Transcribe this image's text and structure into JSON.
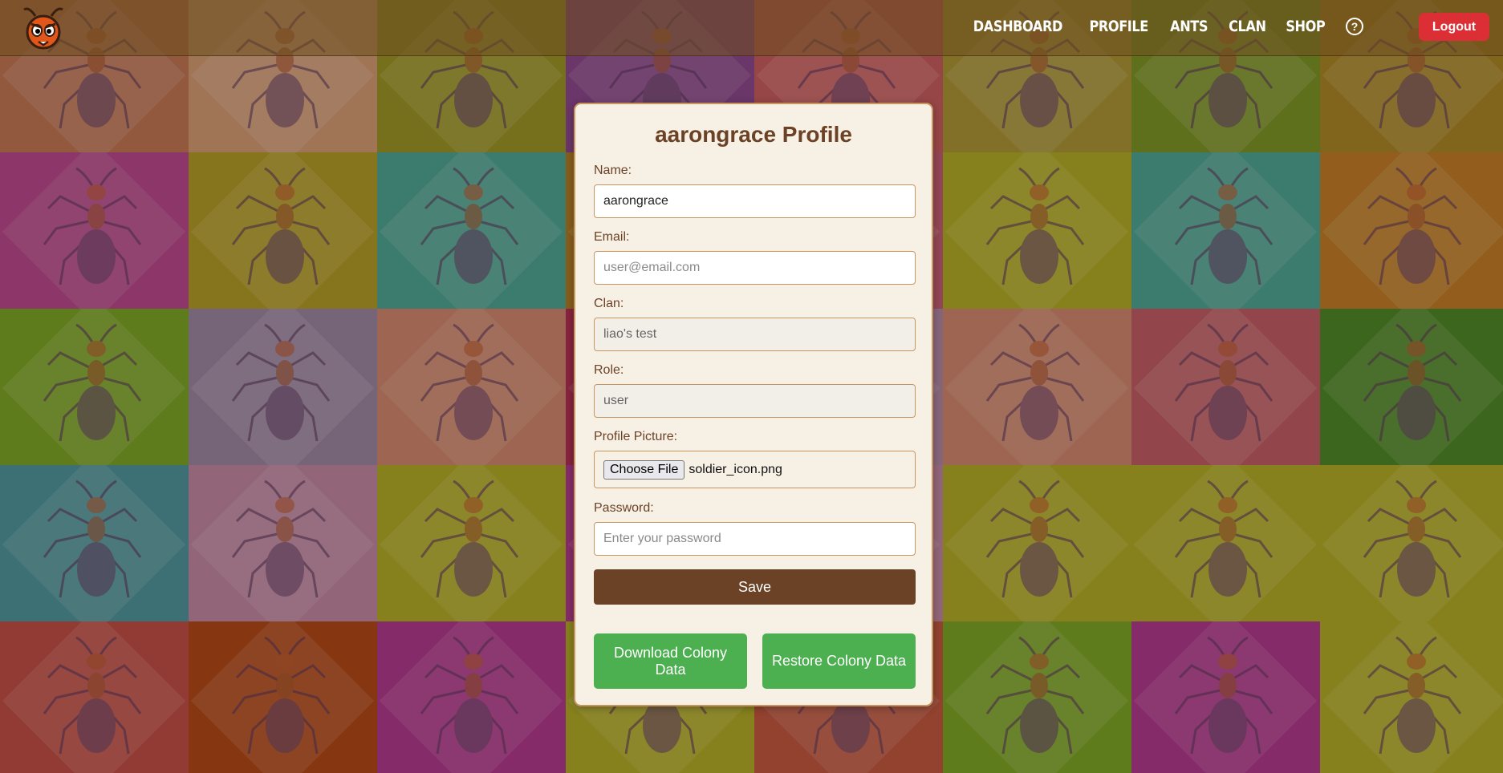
{
  "nav": {
    "links": [
      "DASHBOARD",
      "PROFILE",
      "ANTS",
      "CLAN",
      "SHOP"
    ],
    "logout_label": "Logout"
  },
  "profile": {
    "title": "aarongrace Profile",
    "name_label": "Name:",
    "name_value": "aarongrace",
    "email_label": "Email:",
    "email_placeholder": "user@email.com",
    "clan_label": "Clan:",
    "clan_value": "liao's test",
    "role_label": "Role:",
    "role_value": "user",
    "picture_label": "Profile Picture:",
    "choose_file_label": "Choose File",
    "file_name": "soldier_icon.png",
    "password_label": "Password:",
    "password_placeholder": "Enter your password",
    "save_label": "Save",
    "download_label": "Download Colony Data",
    "restore_label": "Restore Colony Data"
  },
  "colors": {
    "brown": "#6b4226",
    "green": "#4caf50",
    "red": "#dc2f35",
    "card_bg": "#f7f0e5"
  },
  "icons": [
    "ant-logo-icon",
    "help-icon",
    "ant-tile-icon"
  ]
}
